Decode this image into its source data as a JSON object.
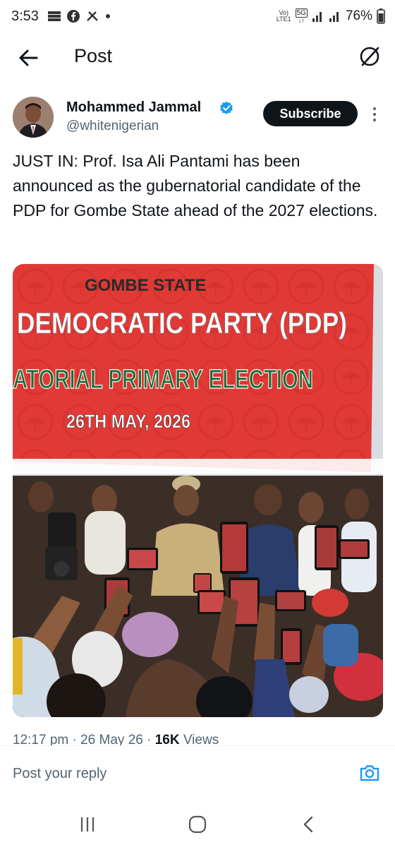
{
  "status_bar": {
    "time": "3:53",
    "volte_top": "Vo)",
    "volte_bottom": "LTE1",
    "network": "5G",
    "battery": "76%"
  },
  "header": {
    "title": "Post"
  },
  "post": {
    "author_name": "Mohammed Jammal",
    "author_handle": "@whitenigerian",
    "subscribe_label": "Subscribe",
    "text": "JUST IN: Prof. Isa Ali Pantami has been announced as the gubernatorial candidate of the PDP for Gombe State ahead of the 2027 elections.",
    "image": {
      "banner_line1": "GOMBE STATE",
      "banner_line2": "DEMOCRATIC PARTY (PDP)",
      "banner_line3": "ATORIAL PRIMARY ELECTION",
      "banner_line4": "26TH MAY, 2026"
    },
    "timestamp": "12:17 pm · 26 May 26 · ",
    "views_count": "16K",
    "views_label": " Views"
  },
  "reply": {
    "placeholder": "Post your reply"
  },
  "colors": {
    "accent": "#1d9bf0",
    "banner_red": "#e23b3b",
    "banner_green": "#1f7a3e"
  },
  "icons": [
    "back-arrow-icon",
    "grok-icon",
    "verified-badge-icon",
    "more-options-icon",
    "camera-icon",
    "recent-apps-icon",
    "home-icon",
    "back-nav-icon"
  ]
}
